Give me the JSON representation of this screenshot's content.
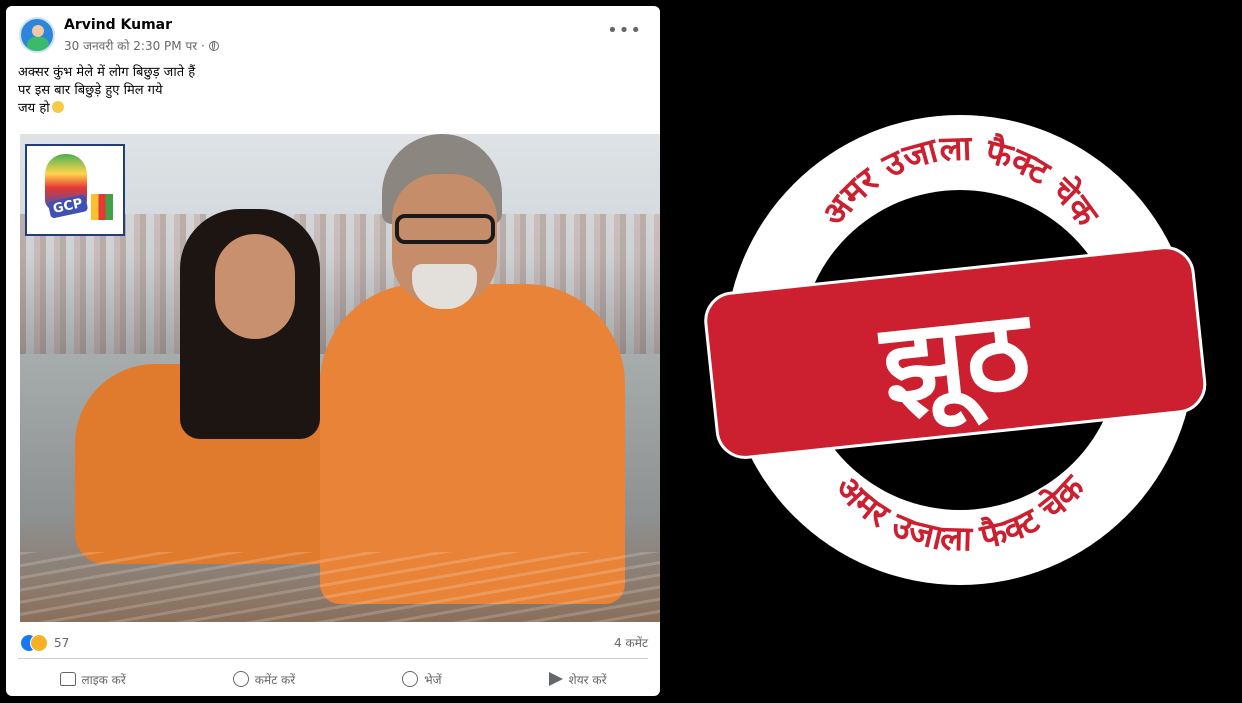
{
  "post": {
    "author": "Arvind Kumar",
    "timestamp": "30 जनवरी को 2:30 PM पर ·",
    "more_label": "•••",
    "caption_lines": [
      "अक्सर कुंभ मेले में लोग बिछुड़ जाते हैं",
      "पर इस बार बिछुड़े हुए मिल गये",
      "जय हो"
    ],
    "image_logo_text": "GCP",
    "reaction_count": "57",
    "comment_count": "4 कमेंट",
    "actions": {
      "like": "लाइक करें",
      "comment": "कमेंट करें",
      "send": "भेजें",
      "share": "शेयर करें"
    },
    "icons": [
      "globe-icon",
      "more-icon",
      "like-reaction-icon",
      "haha-reaction-icon",
      "thumb-icon",
      "comment-icon",
      "whatsapp-icon",
      "share-icon"
    ]
  },
  "stamp": {
    "top_arc": "अमर उजाला फैक्ट चेक",
    "bottom_arc": "अमर उजाला फैक्ट चेक",
    "verdict": "झूठ",
    "colors": {
      "red": "#cc1f2f",
      "white": "#ffffff",
      "background": "#000000"
    }
  }
}
